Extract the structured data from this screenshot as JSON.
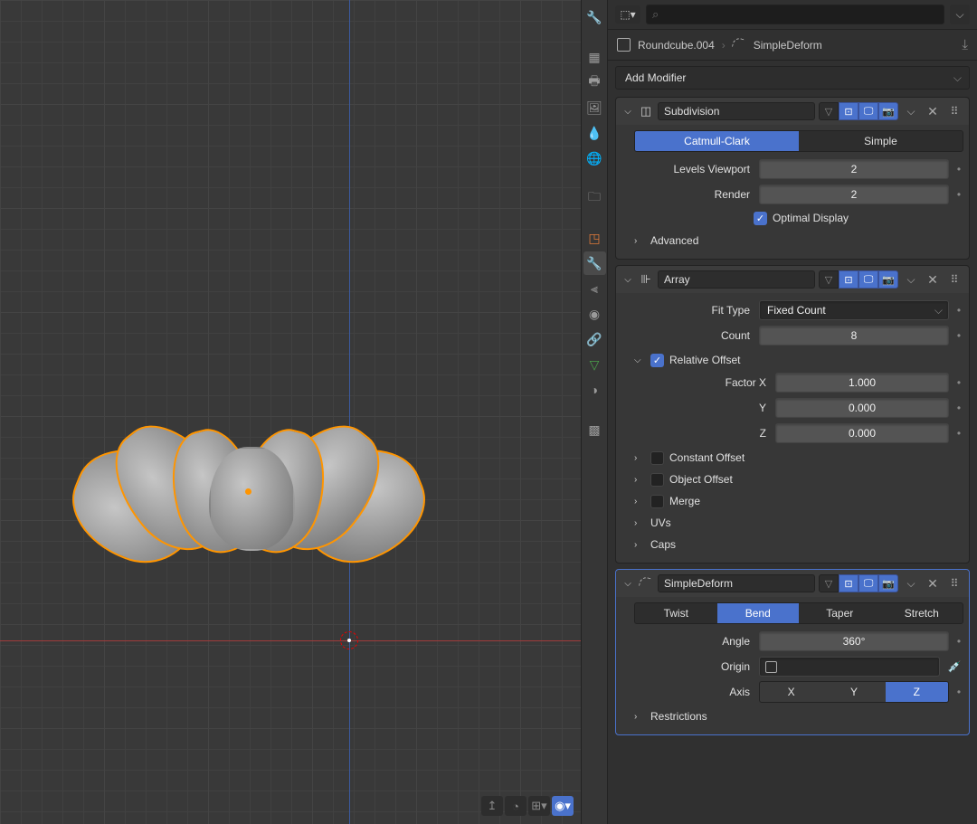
{
  "breadcrumb": {
    "object": "Roundcube.004",
    "modifier": "SimpleDeform"
  },
  "add_modifier": "Add Modifier",
  "search_placeholder": "",
  "modifiers": {
    "subdiv": {
      "name": "Subdivision",
      "tabs": {
        "catmull": "Catmull-Clark",
        "simple": "Simple"
      },
      "levels_label": "Levels Viewport",
      "levels": "2",
      "render_label": "Render",
      "render": "2",
      "optimal": "Optimal Display",
      "advanced": "Advanced"
    },
    "array": {
      "name": "Array",
      "fit_label": "Fit Type",
      "fit": "Fixed Count",
      "count_label": "Count",
      "count": "8",
      "rel_offset": "Relative Offset",
      "fx_label": "Factor X",
      "fx": "1.000",
      "fy_label": "Y",
      "fy": "0.000",
      "fz_label": "Z",
      "fz": "0.000",
      "const_offset": "Constant Offset",
      "obj_offset": "Object Offset",
      "merge": "Merge",
      "uvs": "UVs",
      "caps": "Caps"
    },
    "deform": {
      "name": "SimpleDeform",
      "modes": {
        "twist": "Twist",
        "bend": "Bend",
        "taper": "Taper",
        "stretch": "Stretch"
      },
      "angle_label": "Angle",
      "angle": "360°",
      "origin_label": "Origin",
      "axis_label": "Axis",
      "axes": {
        "x": "X",
        "y": "Y",
        "z": "Z"
      },
      "restrictions": "Restrictions"
    }
  }
}
